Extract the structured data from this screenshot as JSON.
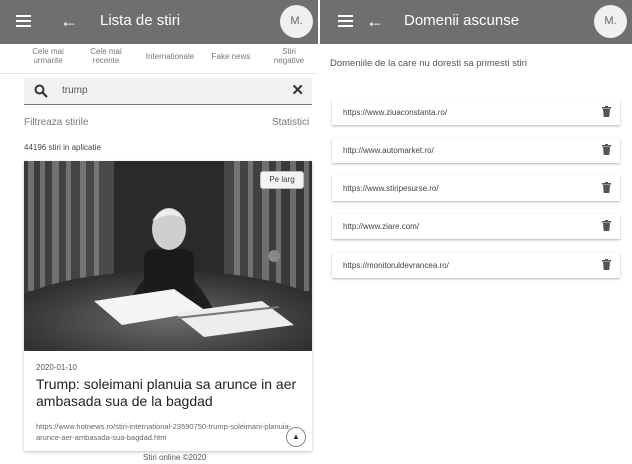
{
  "left": {
    "appbar": {
      "menu_icon": "menu-icon",
      "back_icon": "arrow-left-icon",
      "title": "Lista de stiri",
      "avatar": "M."
    },
    "tabs": [
      {
        "line1": "Cele mai",
        "line2": "urmarite"
      },
      {
        "line1": "Cele mai",
        "line2": "recente"
      },
      {
        "line1": "Internationale",
        "line2": ""
      },
      {
        "line1": "Fake news",
        "line2": ""
      },
      {
        "line1": "Stiri",
        "line2": "negative"
      }
    ],
    "search": {
      "value": "trump",
      "search_icon": "search-icon",
      "clear_icon": "close-icon"
    },
    "filter_label": "Filtreaza stirile",
    "stats_label": "Statistici",
    "count_text": "44196 stiri in aplicatie",
    "article": {
      "badge": "Pe larg",
      "date": "2020-01-10",
      "title": "Trump: soleimani planuia sa arunce in aer ambasada sua de la bagdad",
      "url": "https://www.hotnews.ro/stiri-international-23590750-trump-soleimani-planuia-arunce-aer-ambasada-sua-bagdad.htm",
      "scroll_icon": "chevron-up-icon"
    },
    "footer": "Stiri online ©2020"
  },
  "right": {
    "appbar": {
      "menu_icon": "menu-icon",
      "back_icon": "arrow-left-icon",
      "title": "Domenii ascunse",
      "avatar": "M."
    },
    "description": "Domeniile de la care nu doresti sa primesti stiri",
    "domains": [
      "https://www.ziuaconstanta.ro/",
      "http://www.automarket.ro/",
      "https://www.stiripesurse.ro/",
      "http://www.ziare.com/",
      "https://monitoruldevrancea.ro/"
    ],
    "delete_icon": "trash-icon"
  }
}
